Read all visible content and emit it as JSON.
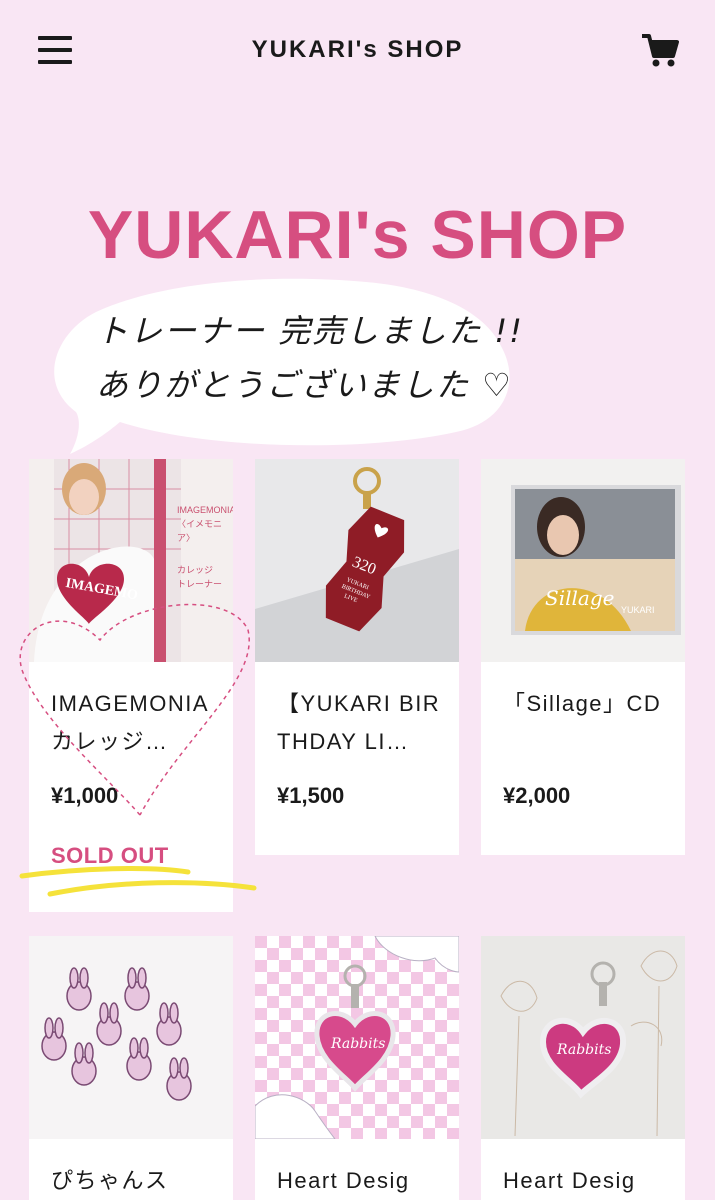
{
  "header": {
    "title": "YUKARI's SHOP",
    "menu_icon": "hamburger-menu-icon",
    "cart_icon": "shopping-cart-icon"
  },
  "hero": {
    "title": "YUKARI's SHOP",
    "bubble_line1": "トレーナー 完売しました !!",
    "bubble_line2": "ありがとうございました ♡"
  },
  "products": [
    {
      "name": "IMAGEMONIA カレッジ…",
      "price": "¥1,000",
      "status": "SOLD OUT"
    },
    {
      "name": "【YUKARI BIRTHDAY LI…",
      "price": "¥1,500"
    },
    {
      "name": "「Sillage」CD",
      "price": "¥2,000"
    },
    {
      "name": "ぴちゃんス",
      "price": ""
    },
    {
      "name": "Heart Desig",
      "price": ""
    },
    {
      "name": "Heart Desig",
      "price": ""
    }
  ],
  "images": {
    "p1_text": [
      "IMAGEMONIA",
      "〈イメモニア〉",
      "カレッジ",
      "トレーナー"
    ],
    "p2_tag": [
      "320",
      "YUKARI",
      "BIRTHDAY",
      "LIVE"
    ],
    "p3_cd": [
      "Sillage",
      "YUKARI"
    ],
    "p5_tag": "Rabbits",
    "p6_tag": "Rabbits"
  },
  "colors": {
    "background": "#f9e6f4",
    "brand_pink": "#d64e80",
    "highlight_yellow": "#f5e23a"
  }
}
